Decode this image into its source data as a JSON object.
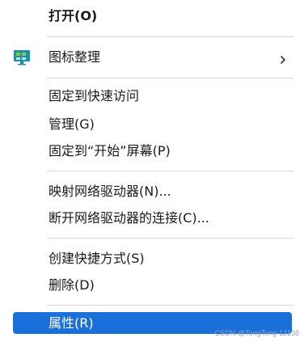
{
  "menu": {
    "open": "打开(O)",
    "arrange_icons": "图标整理",
    "pin_quick_access": "固定到快速访问",
    "manage": "管理(G)",
    "pin_start": "固定到“开始”屏幕(P)",
    "map_drive": "映射网络驱动器(N)...",
    "disconnect_drive": "断开网络驱动器的连接(C)...",
    "create_shortcut": "创建快捷方式(S)",
    "delete": "删除(D)",
    "properties": "属性(R)"
  },
  "icons": {
    "arrange_icons": "desktop-icon",
    "submenu": "chevron-right-icon"
  },
  "colors": {
    "selected_bg": "#1a6fd9",
    "icon_teal": "#1f8fa8",
    "icon_green": "#7ccf3c"
  },
  "watermark": "CSDN @TongTong-12138"
}
